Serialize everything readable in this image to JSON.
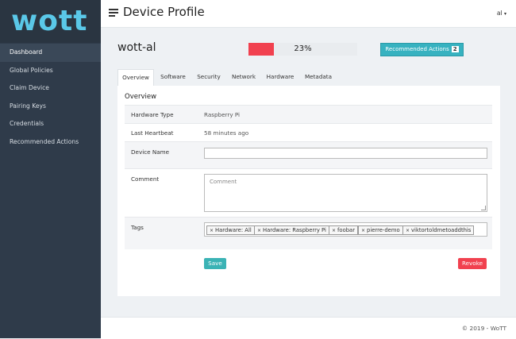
{
  "sidebar": {
    "logo": "wott",
    "items": [
      {
        "label": "Dashboard"
      },
      {
        "label": "Global Policies"
      },
      {
        "label": "Claim Device"
      },
      {
        "label": "Pairing Keys"
      },
      {
        "label": "Credentials"
      },
      {
        "label": "Recommended Actions"
      }
    ]
  },
  "header": {
    "title": "Device Profile",
    "user": "al"
  },
  "device": {
    "name": "wott-al",
    "trust_score_label": "23%",
    "trust_score": 0.23
  },
  "recommended_actions": {
    "label": "Recommended Actions",
    "count": "2"
  },
  "tabs": [
    {
      "label": "Overview"
    },
    {
      "label": "Software"
    },
    {
      "label": "Security"
    },
    {
      "label": "Network"
    },
    {
      "label": "Hardware"
    },
    {
      "label": "Metadata"
    }
  ],
  "overview": {
    "section_title": "Overview",
    "hardware_type_label": "Hardware Type",
    "hardware_type_value": "Raspberry Pi",
    "last_heartbeat_label": "Last Heartbeat",
    "last_heartbeat_value": "58 minutes ago",
    "device_name_label": "Device Name",
    "device_name_value": "",
    "comment_label": "Comment",
    "comment_placeholder": "Comment",
    "tags_label": "Tags",
    "tags": [
      "Hardware: All",
      "Hardware: Raspberry Pi",
      "foobar",
      "pierre-demo",
      "viktortoldmetoaddthis"
    ]
  },
  "actions": {
    "save_label": "Save",
    "revoke_label": "Revoke"
  },
  "footer": {
    "text": "© 2019 - WoTT"
  },
  "colors": {
    "sidebar": "#2f3b4a",
    "accent": "#37b2c0",
    "danger": "#f1414f"
  }
}
